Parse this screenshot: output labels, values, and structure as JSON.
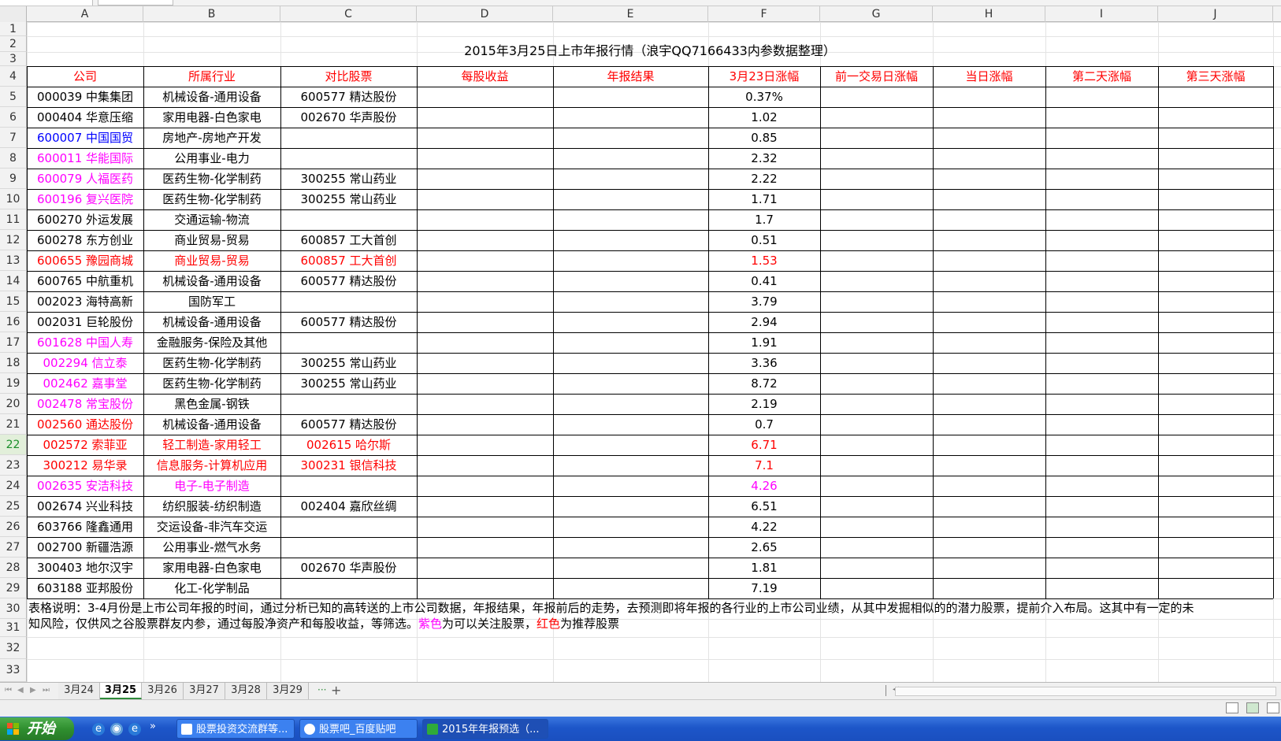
{
  "columns": [
    "A",
    "B",
    "C",
    "D",
    "E",
    "F",
    "G",
    "H",
    "I",
    "J"
  ],
  "title": "2015年3月25日上市年报行情（浪宇QQ7166433内参数据整理）",
  "headers": [
    "公司",
    "所属行业",
    "对比股票",
    "每股收益",
    "年报结果",
    "3月23日涨幅",
    "前一交易日涨幅",
    "当日涨幅",
    "第二天涨幅",
    "第三天涨幅"
  ],
  "row_numbers": [
    "1",
    "2",
    "3",
    "4",
    "5",
    "6",
    "7",
    "8",
    "9",
    "10",
    "11",
    "12",
    "13",
    "14",
    "15",
    "16",
    "17",
    "18",
    "19",
    "20",
    "21",
    "22",
    "23",
    "24",
    "25",
    "26",
    "27",
    "28",
    "29",
    "30",
    "31",
    "32",
    "33"
  ],
  "rows": [
    {
      "company": "000039 中集集团",
      "industry": "机械设备-通用设备",
      "compare": "600577 精达股份",
      "pct": "0.37%",
      "color": "#000000"
    },
    {
      "company": "000404 华意压缩",
      "industry": "家用电器-白色家电",
      "compare": "002670 华声股份",
      "pct": "1.02",
      "color": "#000000"
    },
    {
      "company": "600007 中国国贸",
      "industry": "房地产-房地产开发",
      "compare": "",
      "pct": "0.85",
      "color": "#000000",
      "company_color": "#0000ff"
    },
    {
      "company": "600011 华能国际",
      "industry": "公用事业-电力",
      "compare": "",
      "pct": "2.32",
      "color": "#000000",
      "company_color": "#ff00ff"
    },
    {
      "company": "600079 人福医药",
      "industry": "医药生物-化学制药",
      "compare": "300255 常山药业",
      "pct": "2.22",
      "color": "#000000",
      "company_color": "#ff00ff"
    },
    {
      "company": "600196 复兴医院",
      "industry": "医药生物-化学制药",
      "compare": "300255 常山药业",
      "pct": "1.71",
      "color": "#000000",
      "company_color": "#ff00ff"
    },
    {
      "company": "600270 外运发展",
      "industry": "交通运输-物流",
      "compare": "",
      "pct": "1.7",
      "color": "#000000"
    },
    {
      "company": "600278 东方创业",
      "industry": "商业贸易-贸易",
      "compare": "600857 工大首创",
      "pct": "0.51",
      "color": "#000000"
    },
    {
      "company": "600655 豫园商城",
      "industry": "商业贸易-贸易",
      "compare": "600857 工大首创",
      "pct": "1.53",
      "color": "#ff0000"
    },
    {
      "company": "600765 中航重机",
      "industry": "机械设备-通用设备",
      "compare": "600577 精达股份",
      "pct": "0.41",
      "color": "#000000"
    },
    {
      "company": "002023 海特高新",
      "industry": "国防军工",
      "compare": "",
      "pct": "3.79",
      "color": "#000000"
    },
    {
      "company": "002031 巨轮股份",
      "industry": "机械设备-通用设备",
      "compare": "600577 精达股份",
      "pct": "2.94",
      "color": "#000000"
    },
    {
      "company": "601628 中国人寿",
      "industry": "金融服务-保险及其他",
      "compare": "",
      "pct": "1.91",
      "color": "#000000",
      "company_color": "#ff00ff"
    },
    {
      "company": "002294 信立泰",
      "industry": "医药生物-化学制药",
      "compare": "300255 常山药业",
      "pct": "3.36",
      "color": "#000000",
      "company_color": "#ff00ff"
    },
    {
      "company": "002462 嘉事堂",
      "industry": "医药生物-化学制药",
      "compare": "300255 常山药业",
      "pct": "8.72",
      "color": "#000000",
      "company_color": "#ff00ff"
    },
    {
      "company": "002478 常宝股份",
      "industry": "黑色金属-钢铁",
      "compare": "",
      "pct": "2.19",
      "color": "#000000",
      "company_color": "#ff00ff"
    },
    {
      "company": "002560 通达股份",
      "industry": "机械设备-通用设备",
      "compare": "600577 精达股份",
      "pct": "0.7",
      "color": "#000000",
      "company_color": "#ff0000"
    },
    {
      "company": "002572 索菲亚",
      "industry": "轻工制造-家用轻工",
      "compare": "002615 哈尔斯",
      "pct": "6.71",
      "color": "#ff0000"
    },
    {
      "company": "300212 易华录",
      "industry": "信息服务-计算机应用",
      "compare": "300231 银信科技",
      "pct": "7.1",
      "color": "#ff0000"
    },
    {
      "company": "002635 安洁科技",
      "industry": "电子-电子制造",
      "compare": "",
      "pct": "4.26",
      "color": "#ff00ff"
    },
    {
      "company": "002674 兴业科技",
      "industry": "纺织服装-纺织制造",
      "compare": "002404 嘉欣丝绸",
      "pct": "6.51",
      "color": "#000000"
    },
    {
      "company": "603766 隆鑫通用",
      "industry": "交运设备-非汽车交运",
      "compare": "",
      "pct": "4.22",
      "color": "#000000"
    },
    {
      "company": "002700 新疆浩源",
      "industry": "公用事业-燃气水务",
      "compare": "",
      "pct": "2.65",
      "color": "#000000"
    },
    {
      "company": "300403 地尔汉宇",
      "industry": "家用电器-白色家电",
      "compare": "002670 华声股份",
      "pct": "1.81",
      "color": "#000000"
    },
    {
      "company": "603188 亚邦股份",
      "industry": "化工-化学制品",
      "compare": "",
      "pct": "7.19",
      "color": "#000000"
    }
  ],
  "note": {
    "line1": "表格说明：3-4月份是上市公司年报的时间，通过分析已知的高转送的上市公司数据，年报结果，年报前后的走势，去预测即将年报的各行业的上市公司业绩，从其中发掘相似的的潜力股票，提前介入布局。这其中有一定的未",
    "line2_a": "知风险，仅供风之谷股票群友内参，通过每股净资产和每股收益，等筛选。",
    "purple": "紫色",
    "line2_b": "为可以关注股票，",
    "red": "红色",
    "line2_c": "为推荐股票"
  },
  "sheet_tabs": [
    "3月24",
    "3月25",
    "3月26",
    "3月27",
    "3月28",
    "3月29"
  ],
  "active_tab": "3月25",
  "tab_more": "···",
  "tab_add": "+",
  "taskbar": {
    "start": "开始",
    "chevron": "»",
    "windows": [
      "股票投资交流群等...",
      "股票吧_百度贴吧",
      "2015年年报预选（..."
    ]
  },
  "colors": {
    "header_red": "#ff0000",
    "purple": "#ff00ff",
    "blue": "#0000ff",
    "active_row": "#1a8f2a"
  }
}
